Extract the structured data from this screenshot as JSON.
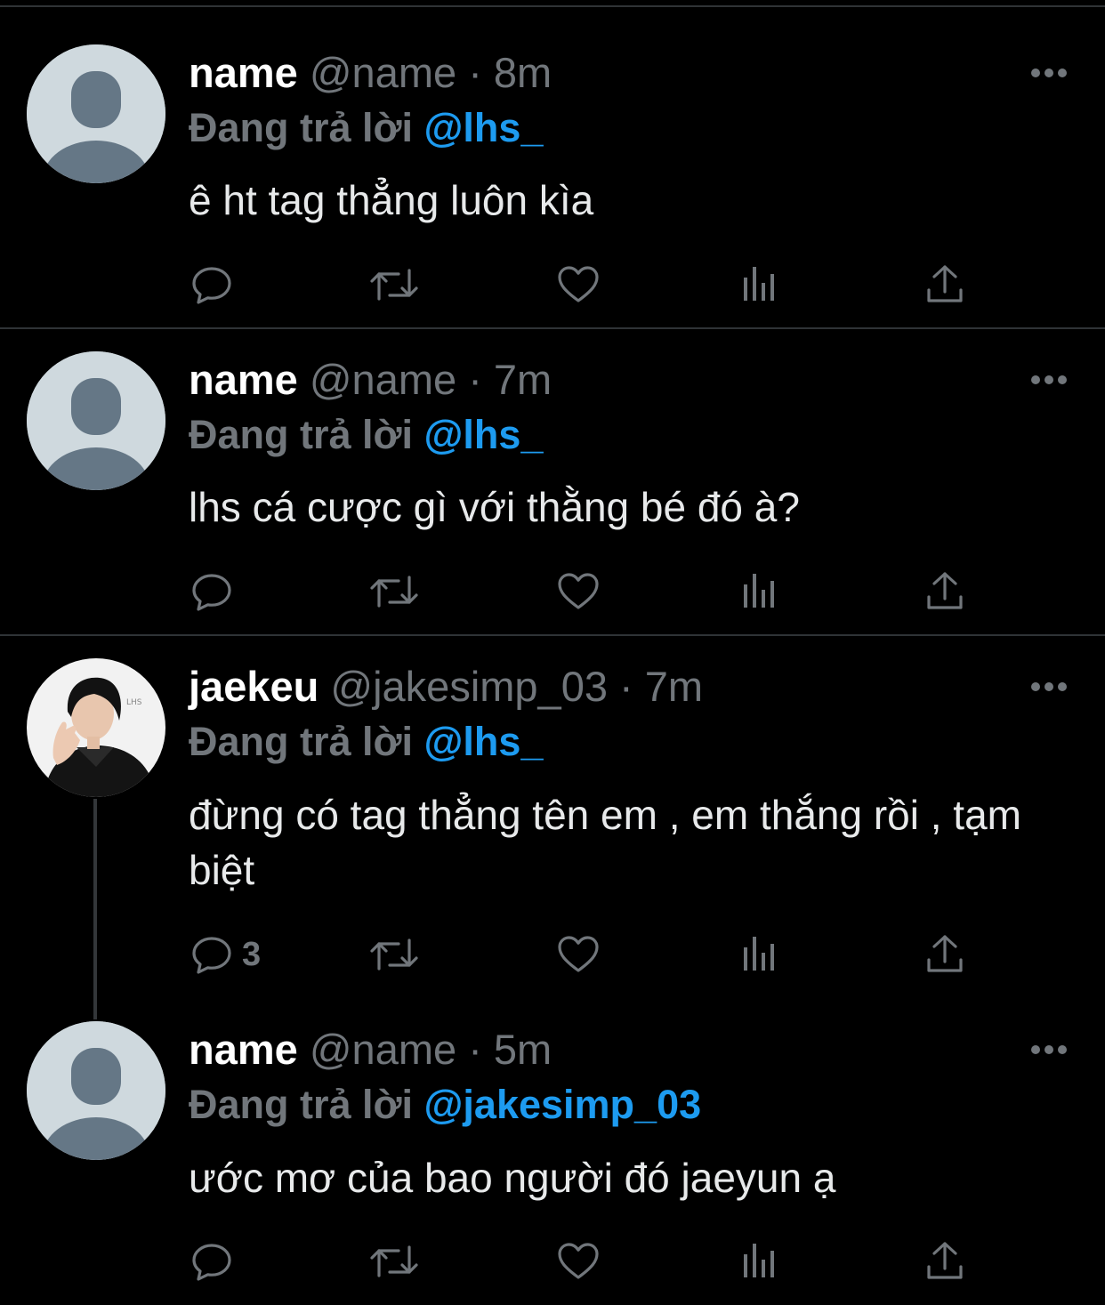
{
  "colors": {
    "background": "#000000",
    "muted": "#71767b",
    "accent": "#1d9bf0",
    "divider": "#2f3336"
  },
  "icons": {
    "more": "more-horizontal-icon",
    "reply": "reply-icon",
    "retweet": "retweet-icon",
    "like": "heart-icon",
    "views": "views-icon",
    "share": "share-icon"
  },
  "tweets": [
    {
      "display_name": "name",
      "handle": "@name",
      "dot": "·",
      "time": "8m",
      "reply_prefix": "Đang trả lời",
      "reply_to": "@lhs_",
      "text": "ê ht tag thẳng luôn kìa",
      "reply_count": ""
    },
    {
      "display_name": "name",
      "handle": "@name",
      "dot": "·",
      "time": "7m",
      "reply_prefix": "Đang trả lời",
      "reply_to": "@lhs_",
      "text": "lhs cá cược gì với thằng bé đó à?",
      "reply_count": ""
    },
    {
      "display_name": "jaekeu",
      "handle": "@jakesimp_03",
      "dot": "·",
      "time": "7m",
      "reply_prefix": "Đang trả lời",
      "reply_to": "@lhs_",
      "text": "đừng có tag thẳng tên em , em thắng rồi , tạm biệt",
      "reply_count": "3"
    },
    {
      "display_name": "name",
      "handle": "@name",
      "dot": "·",
      "time": "5m",
      "reply_prefix": "Đang trả lời",
      "reply_to": "@jakesimp_03",
      "text": "ước mơ của bao người đó jaeyun ạ",
      "reply_count": ""
    }
  ]
}
